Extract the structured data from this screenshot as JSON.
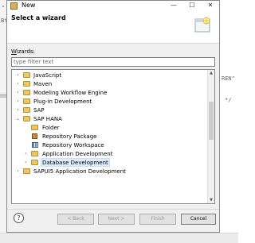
{
  "background": {
    "fragments": [
      "\"",
      "Bt",
      "REN\"",
      "*/"
    ]
  },
  "window": {
    "title": "New",
    "controls": {
      "minimize": "—",
      "maximize": "☐",
      "close": "✕"
    }
  },
  "header": {
    "title": "Select a wizard"
  },
  "wizards": {
    "label_mnemonic": "W",
    "label_rest": "izards:",
    "filter_placeholder": "type filter text"
  },
  "tree": {
    "items": [
      {
        "label": "JavaScript",
        "icon": "folder-icon",
        "expander": "›"
      },
      {
        "label": "Maven",
        "icon": "folder-icon",
        "expander": "›"
      },
      {
        "label": "Modeling Workflow Engine",
        "icon": "folder-icon",
        "expander": "›"
      },
      {
        "label": "Plug-in Development",
        "icon": "folder-icon",
        "expander": "›"
      },
      {
        "label": "SAP",
        "icon": "folder-icon",
        "expander": "›"
      },
      {
        "label": "SAP HANA",
        "icon": "folder-icon",
        "expander": "⌄"
      },
      {
        "label": "Folder",
        "icon": "folder-icon",
        "expander": ""
      },
      {
        "label": "Repository Package",
        "icon": "package-icon",
        "expander": ""
      },
      {
        "label": "Repository Workspace",
        "icon": "workspace-icon",
        "expander": ""
      },
      {
        "label": "Application Development",
        "icon": "folder-icon",
        "expander": "›"
      },
      {
        "label": "Database Development",
        "icon": "folder-icon",
        "expander": "›"
      },
      {
        "label": "SAPUI5 Application Development",
        "icon": "folder-icon",
        "expander": "›"
      }
    ],
    "selected_index": 10
  },
  "footer": {
    "help": "?",
    "back": "< Back",
    "next": "Next >",
    "finish": "Finish",
    "cancel": "Cancel"
  },
  "colors": {
    "selection": "#dcecfc",
    "folder": "#e9c865"
  }
}
